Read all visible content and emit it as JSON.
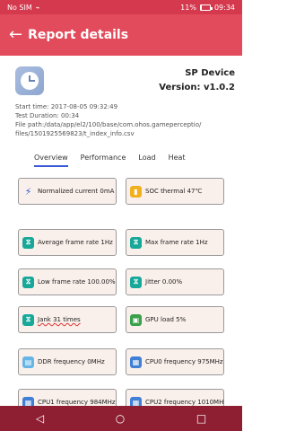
{
  "status": {
    "carrier": "No SIM",
    "battery": "11%",
    "battery_level": 0.11,
    "time": "09:34"
  },
  "appbar": {
    "title": "Report details"
  },
  "device": {
    "name": "SP Device",
    "version": "Version: v1.0.2"
  },
  "meta": {
    "start": "Start time: 2017-08-05 09:32:49",
    "duration": "Test Duration: 00:34",
    "path1": "File path:/data/app/el2/100/base/com.ohos.gameperceptio/",
    "path2": "files/1501925569823/t_index_info.csv"
  },
  "tabs": [
    "Overview",
    "Performance",
    "Load",
    "Heat"
  ],
  "cards": [
    {
      "label": "Normalized current  0mA",
      "icon": "lightning-icon"
    },
    {
      "label": "SOC thermal  47℃",
      "icon": "thermometer-icon"
    },
    {
      "label": "Average frame rate  1Hz",
      "icon": "hourglass-icon"
    },
    {
      "label": "Max frame rate  1Hz",
      "icon": "hourglass-icon"
    },
    {
      "label": "Low frame rate  100.00%",
      "icon": "hourglass-icon"
    },
    {
      "label": "Jitter  0.00%",
      "icon": "hourglass-icon"
    },
    {
      "label": "Jank  31 times",
      "icon": "hourglass-icon"
    },
    {
      "label": "GPU load   5%",
      "icon": "gpu-icon"
    },
    {
      "label": "DDR frequency  0MHz",
      "icon": "ddr-icon"
    },
    {
      "label": "CPU0 frequency  975MHz",
      "icon": "cpu-icon"
    },
    {
      "label": "CPU1 frequency  984MHz",
      "icon": "cpu-icon"
    },
    {
      "label": "CPU2 frequency  1010MHz",
      "icon": "cpu-icon"
    }
  ],
  "nav": {
    "back": "◁",
    "home": "○",
    "recent": "□"
  }
}
